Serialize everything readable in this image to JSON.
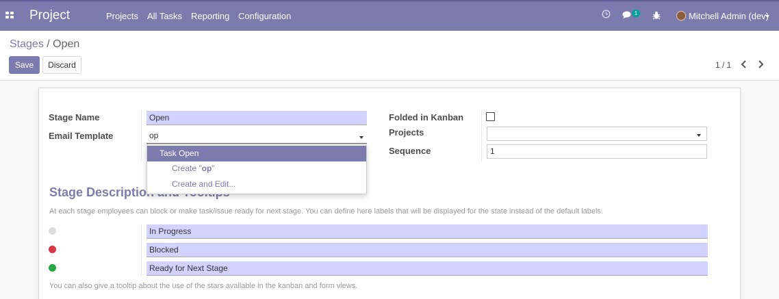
{
  "navbar": {
    "brand": "Project",
    "menu": [
      "Projects",
      "All Tasks",
      "Reporting",
      "Configuration"
    ],
    "notification_count": "1",
    "user": "Mitchell Admin (dev)",
    "icons": [
      "apps-grid-icon",
      "clock-icon",
      "chat-icon",
      "bug-icon"
    ]
  },
  "breadcrumb": {
    "parent": "Stages",
    "separator": "/",
    "current": "Open"
  },
  "buttons": {
    "save": "Save",
    "discard": "Discard"
  },
  "pager": {
    "value": "1 / 1"
  },
  "form": {
    "stage_name_label": "Stage Name",
    "stage_name_value": "Open",
    "email_template_label": "Email Template",
    "email_template_value": "op",
    "folded_label": "Folded in Kanban",
    "folded_checked": false,
    "projects_label": "Projects",
    "projects_value": "",
    "sequence_label": "Sequence",
    "sequence_value": "1"
  },
  "autocomplete": {
    "options": [
      "Task Open",
      "Create \"op\"",
      "Create and Edit..."
    ],
    "create_prefix": "Create \"",
    "create_term": "op",
    "create_suffix": "\""
  },
  "section": {
    "title": "Stage Description and Tooltips",
    "help": "At each stage employees can block or make task/issue ready for next stage. You can define here labels that will be displayed for the state instead of the default labels.",
    "labels": [
      {
        "status": "normal",
        "color": "#dcdcdc",
        "value": "In Progress"
      },
      {
        "status": "blocked",
        "color": "#dc3545",
        "value": "Blocked"
      },
      {
        "status": "done",
        "color": "#28a745",
        "value": "Ready for Next Stage"
      }
    ],
    "footer_help": "You can also give a tooltip about the use of the stars available in the kanban and form views."
  },
  "colors": {
    "brand": "#7c7bad",
    "field_bg": "#d2d2ff"
  }
}
